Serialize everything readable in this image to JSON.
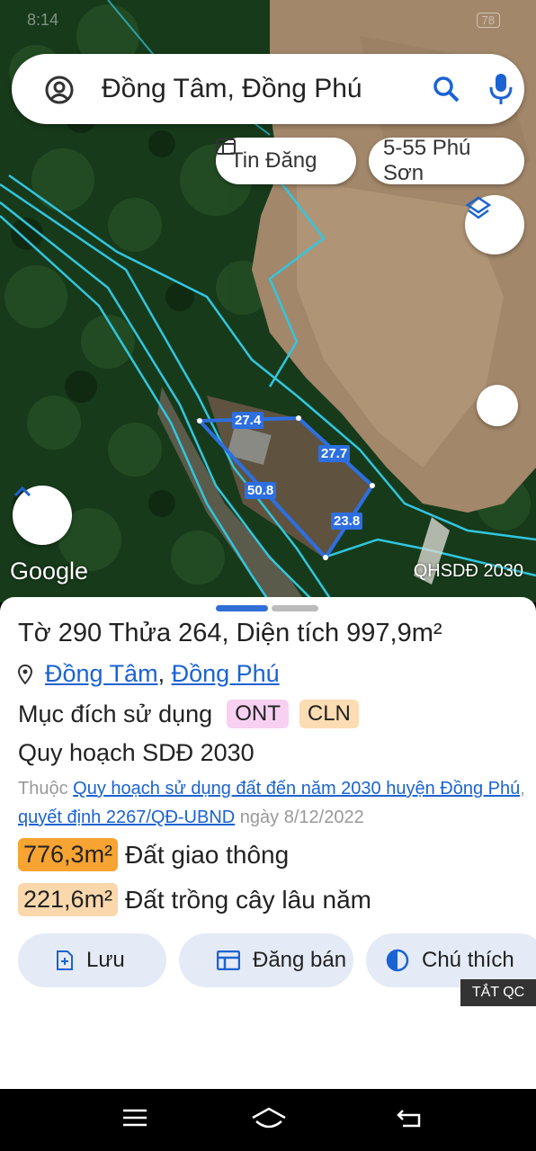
{
  "status": {
    "time": "8:14",
    "battery": "78"
  },
  "search": {
    "query": "Đồng Tâm, Đồng Phú"
  },
  "chips": {
    "listing": "Tin Đăng",
    "address": "5-55 Phú Sơn"
  },
  "map": {
    "google_label": "Google",
    "layer_label": "QHSDĐ 2030",
    "segments": [
      "27.4",
      "27.7",
      "50.8",
      "23.8"
    ]
  },
  "parcel": {
    "title": "Tờ 290 Thửa 264, Diện tích 997,9m²",
    "location_commune": "Đồng Tâm",
    "location_comma": ",",
    "location_district": "Đồng Phú",
    "purpose_label": "Mục đích sử dụng",
    "purpose_tags": [
      "ONT",
      "CLN"
    ],
    "plan_title": "Quy hoạch SDĐ 2030",
    "note_prefix": "Thuộc",
    "note_link": "Quy hoạch sử dụng đất đến năm 2030 huyện Đồng Phú",
    "note_comma": ",",
    "note_decision": "quyết định 2267/QĐ-UBND",
    "note_date": "ngày 8/12/2022",
    "areas": [
      {
        "amount": "776,3m²",
        "label": "Đất giao thông",
        "color": "#f7a432"
      },
      {
        "amount": "221,6m²",
        "label": "Đất trồng cây lâu năm",
        "color": "#fad8ac"
      }
    ]
  },
  "actions": {
    "save": "Lưu",
    "post": "Đăng bán",
    "legend": "Chú thích"
  },
  "ad_badge": "TẮT QC",
  "colors": {
    "accent": "#1b63d2",
    "sheet_button": "#e4ebf6",
    "parcel_outline": "#2d6fe0"
  }
}
